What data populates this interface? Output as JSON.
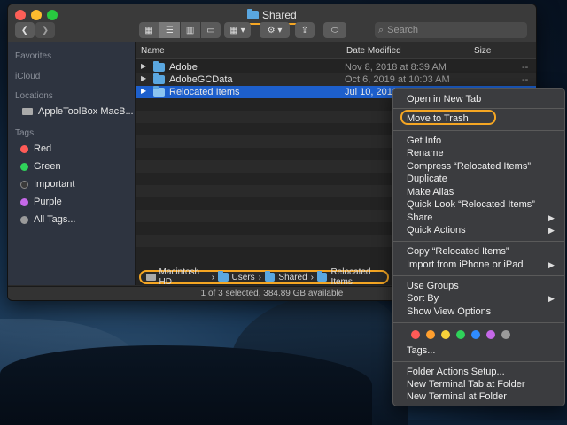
{
  "window": {
    "title": "Shared",
    "search_placeholder": "Search"
  },
  "sidebar": {
    "favorites_head": "Favorites",
    "icloud_head": "iCloud",
    "locations_head": "Locations",
    "location_item": "AppleToolBox MacB...",
    "tags_head": "Tags",
    "tags": [
      {
        "label": "Red",
        "color": "#ff5b57"
      },
      {
        "label": "Green",
        "color": "#2fd25a"
      },
      {
        "label": "Important",
        "color": "#3a3a3a"
      },
      {
        "label": "Purple",
        "color": "#c568e8"
      },
      {
        "label": "All Tags...",
        "color": "#9a9a9a"
      }
    ]
  },
  "list": {
    "col_name": "Name",
    "col_date": "Date Modified",
    "col_size": "Size",
    "rows": [
      {
        "name": "Adobe",
        "date": "Nov 8, 2018 at 8:39 AM",
        "size": "--"
      },
      {
        "name": "AdobeGCData",
        "date": "Oct 6, 2019 at 10:03 AM",
        "size": "--"
      },
      {
        "name": "Relocated Items",
        "date": "Jul 10, 2019",
        "size": ""
      }
    ]
  },
  "pathbar": {
    "items": [
      "Macintosh HD",
      "Users",
      "Shared",
      "Relocated Items"
    ]
  },
  "status": "1 of 3 selected, 384.89 GB available",
  "menu": {
    "open_new_tab": "Open in New Tab",
    "move_to_trash": "Move to Trash",
    "get_info": "Get Info",
    "rename": "Rename",
    "compress": "Compress “Relocated Items”",
    "duplicate": "Duplicate",
    "make_alias": "Make Alias",
    "quick_look": "Quick Look “Relocated Items”",
    "share": "Share",
    "quick_actions": "Quick Actions",
    "copy": "Copy “Relocated Items”",
    "import": "Import from iPhone or iPad",
    "use_groups": "Use Groups",
    "sort_by": "Sort By",
    "show_view_options": "Show View Options",
    "tags": "Tags...",
    "folder_actions": "Folder Actions Setup...",
    "new_terminal_tab": "New Terminal Tab at Folder",
    "new_terminal": "New Terminal at Folder",
    "tag_colors": [
      "#ff5b57",
      "#ff9f2e",
      "#f7d23a",
      "#2fd25a",
      "#2f8cff",
      "#c568e8",
      "#9a9a9a"
    ]
  }
}
